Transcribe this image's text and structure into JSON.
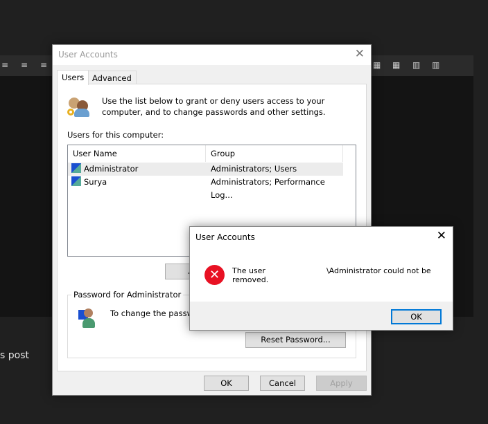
{
  "background": {
    "post_text": "s post"
  },
  "main_dialog": {
    "title": "User Accounts",
    "tabs": [
      {
        "label": "Users",
        "active": true
      },
      {
        "label": "Advanced",
        "active": false
      }
    ],
    "intro": "Use the list below to grant or deny users access to your computer, and to change passwords and other settings.",
    "users_label": "Users for this computer:",
    "columns": [
      "User Name",
      "Group"
    ],
    "rows": [
      {
        "name": "Administrator",
        "group": "Administrators; Users",
        "selected": true
      },
      {
        "name": "Surya",
        "group": "Administrators; Performance Log..."
      }
    ],
    "add_button_partial": "A",
    "password_group": "Password for Administrator",
    "password_text": "To change the passwo",
    "reset_button": "Reset Password...",
    "ok": "OK",
    "cancel": "Cancel",
    "apply": "Apply"
  },
  "error_dialog": {
    "title": "User Accounts",
    "message_start": "The user",
    "message_end": "\\Administrator could not be removed.",
    "ok": "OK",
    "icon_color": "#e81123"
  }
}
